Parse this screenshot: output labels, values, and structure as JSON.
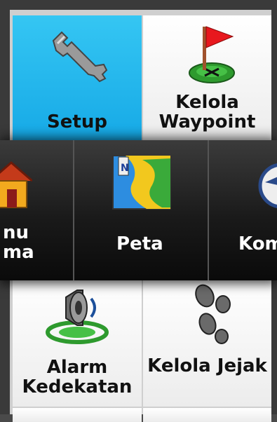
{
  "top_tiles": [
    {
      "label": "Setup",
      "icon": "wrench-icon",
      "selected": true
    },
    {
      "label_line1": "Kelola",
      "label_line2": "Waypoint",
      "icon": "waypoint-flag-icon"
    }
  ],
  "carousel": [
    {
      "label_line1": "nu",
      "label_line2": "ma",
      "icon": "home-icon"
    },
    {
      "label": "Peta",
      "icon": "map-icon"
    },
    {
      "label": "Kom",
      "icon": "compass-icon"
    }
  ],
  "bottom_tiles": [
    {
      "label_line1": "Alarm",
      "label_line2": "Kedekatan",
      "icon": "proximity-alarm-icon"
    },
    {
      "label": "Kelola Jejak",
      "icon": "footprints-icon"
    }
  ],
  "colors": {
    "selected": "#1faeea",
    "band": "#111111"
  }
}
